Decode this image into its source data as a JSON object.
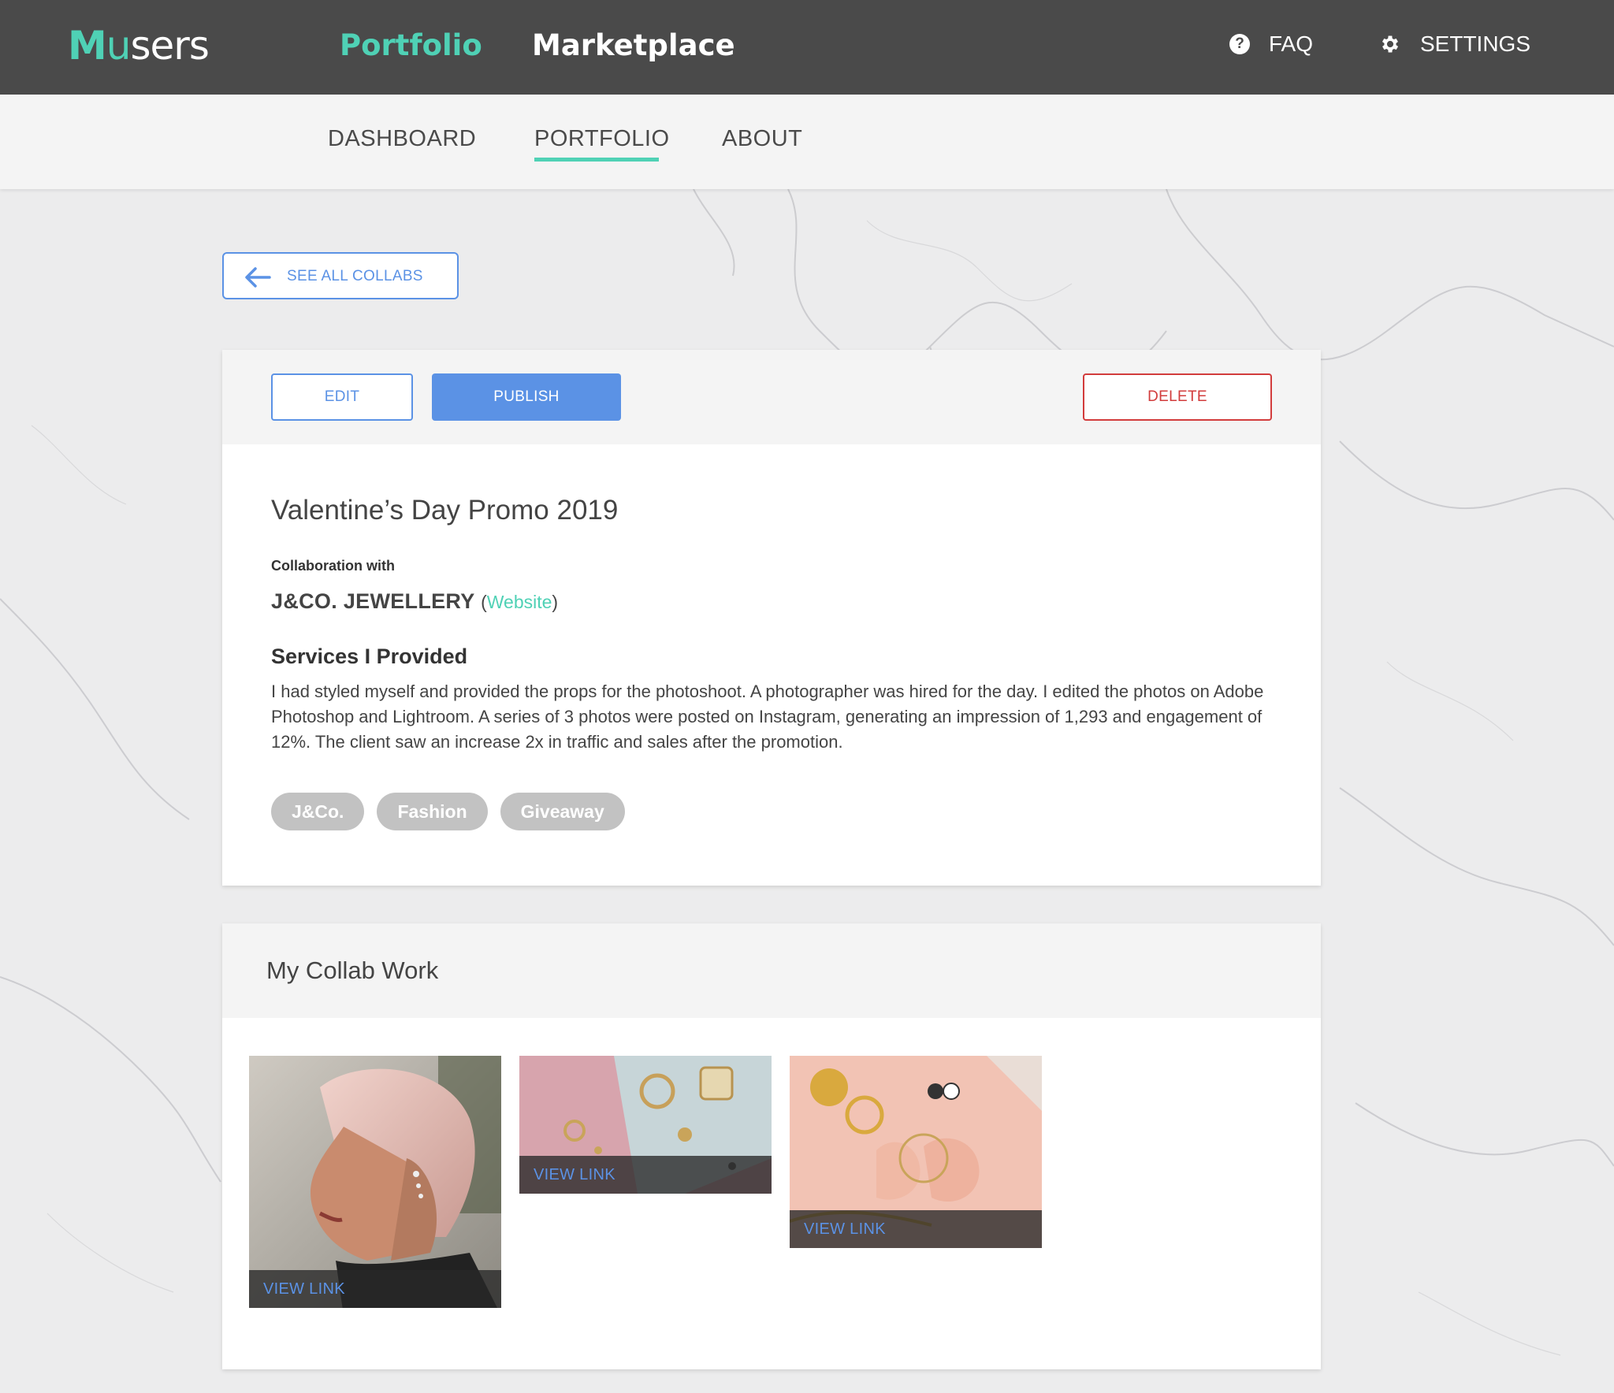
{
  "brand": {
    "logo_m": "M",
    "logo_u": "u",
    "logo_rest": "sers"
  },
  "topnav": {
    "portfolio": "Portfolio",
    "marketplace": "Marketplace",
    "faq_icon_glyph": "?",
    "faq": "FAQ",
    "settings": "SETTINGS"
  },
  "subnav": {
    "items": [
      "DASHBOARD",
      "PORTFOLIO",
      "ABOUT"
    ],
    "active": "PORTFOLIO"
  },
  "back_button": "SEE ALL COLLABS",
  "actions": {
    "edit": "EDIT",
    "publish": "PUBLISH",
    "delete": "DELETE"
  },
  "collab": {
    "title": "Valentine’s Day Promo 2019",
    "with_label": "Collaboration with",
    "brand_name": "J&CO. JEWELLERY",
    "open_paren": "(",
    "website_label": "Website",
    "close_paren": ")",
    "services_heading": "Services I Provided",
    "services_text": "I had styled myself and provided the props for the photoshoot. A photographer was hired for the day. I edited the photos on Adobe Photoshop and Lightroom. A series of 3 photos were posted on Instagram, generating an impression of 1,293 and engagement of 12%. The client saw an increase 2x in traffic and sales after the promotion.",
    "tags": [
      "J&Co.",
      "Fashion",
      "Giveaway"
    ]
  },
  "work": {
    "title": "My Collab Work",
    "items": [
      {
        "image": "portrait-woman-pink-hair-earrings",
        "link_label": "VIEW LINK"
      },
      {
        "image": "jewelry-flatlay-rings-bracelet",
        "link_label": "VIEW LINK"
      },
      {
        "image": "hands-with-jewelry-pink-background",
        "link_label": "VIEW LINK"
      }
    ]
  },
  "colors": {
    "accent": "#4fd1b5",
    "primary": "#5b92e5",
    "danger": "#d23c3c",
    "topbar": "#4a4a4a",
    "tag": "#c2c2c2"
  }
}
